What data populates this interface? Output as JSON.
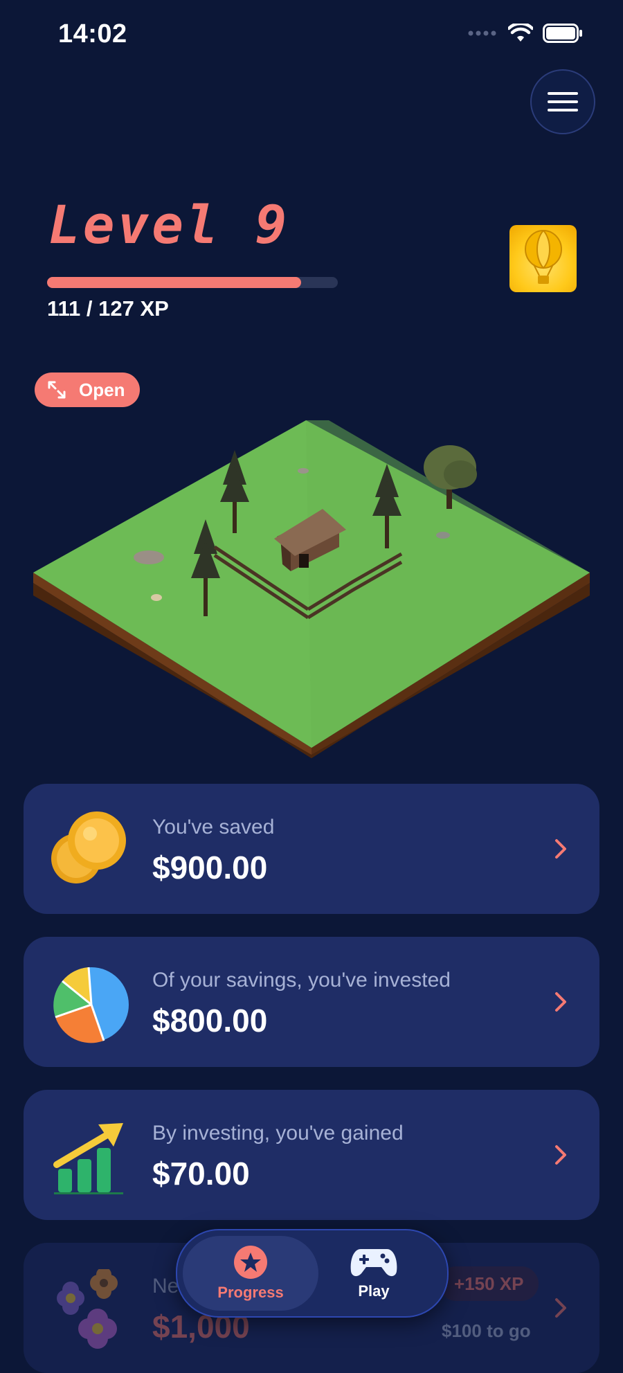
{
  "status": {
    "time": "14:02"
  },
  "header": {
    "menu_icon": "hamburger-icon"
  },
  "level": {
    "title": "Level 9",
    "xp_text": "111 / 127 XP",
    "xp_progress": 0.874
  },
  "badge": {
    "icon": "hot-air-balloon-icon"
  },
  "scene": {
    "open_label": "Open",
    "expand_icon": "expand-arrows-icon"
  },
  "cards": [
    {
      "label": "You've saved",
      "value": "$900.00",
      "icon": "coins-icon"
    },
    {
      "label": "Of your savings, you've invested",
      "value": "$800.00",
      "icon": "pie-chart-icon"
    },
    {
      "label": "By investing, you've gained",
      "value": "$70.00",
      "icon": "growth-chart-icon"
    },
    {
      "label": "Ne",
      "value": "$1,000",
      "icon": "flowers-icon",
      "xp_chip": "+150 XP",
      "to_go": "$100 to go"
    }
  ],
  "tabbar": {
    "tabs": [
      {
        "label": "Progress",
        "icon": "star-icon",
        "active": true
      },
      {
        "label": "Play",
        "icon": "gamepad-icon",
        "active": false
      }
    ]
  },
  "colors": {
    "accent": "#f57a73",
    "background": "#0c1737",
    "card": "#1f2d66"
  }
}
